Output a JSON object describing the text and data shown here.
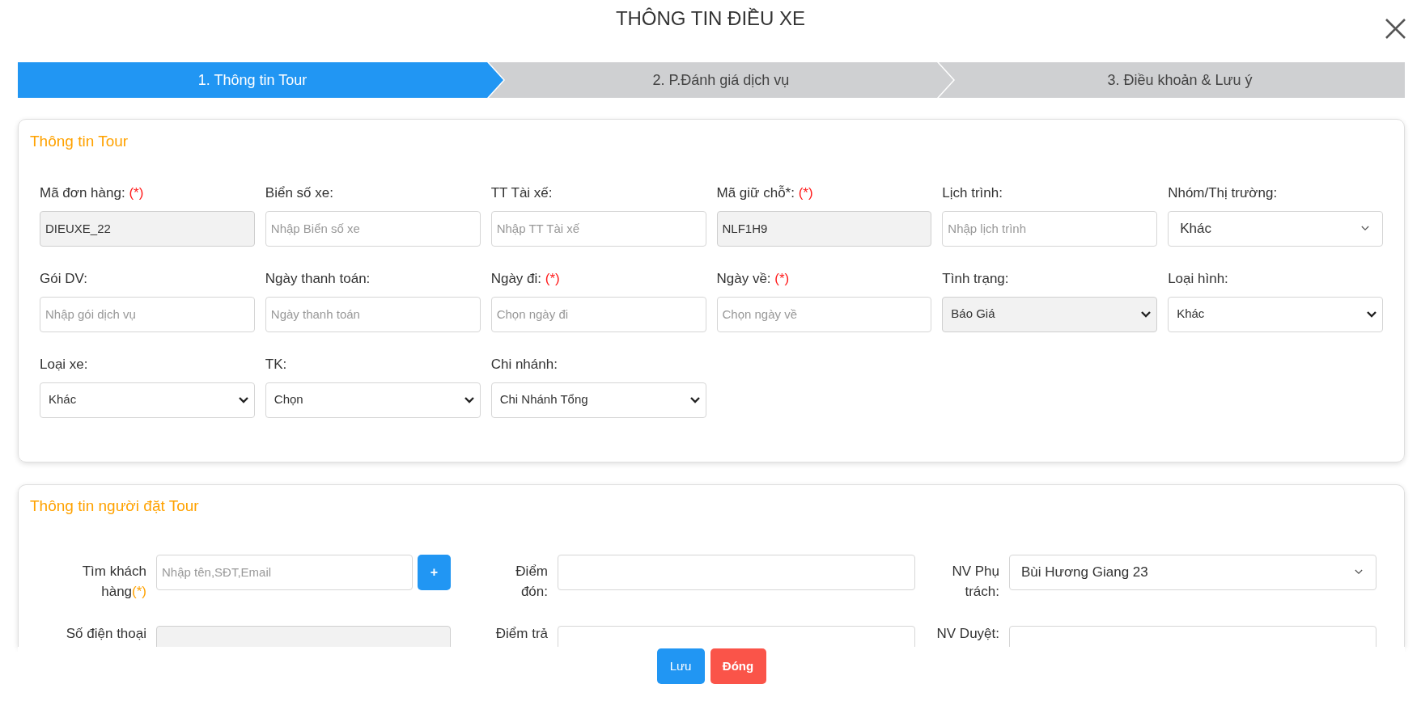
{
  "window": {
    "title": "THÔNG TIN ĐIỀU XE"
  },
  "steps": [
    {
      "label": "1. Thông tin Tour",
      "selected": true
    },
    {
      "label": "2. P.Đánh giá dịch vụ",
      "selected": false
    },
    {
      "label": "3. Điều khoản & Lưu ý",
      "selected": false
    }
  ],
  "tour_info": {
    "title": "Thông tin Tour",
    "fields": [
      {
        "label": "Mã đơn hàng:",
        "mark": "(*)",
        "kind": "input",
        "value": "DIEUXE_22",
        "disabled": true
      },
      {
        "label": "Biển số xe:",
        "kind": "input",
        "placeholder": "Nhập Biển số xe",
        "disabled": false
      },
      {
        "label": "TT Tài xế:",
        "kind": "input",
        "placeholder": "Nhập TT Tài xế",
        "disabled": false
      },
      {
        "label": "Mã giữ chỗ*:",
        "mark": "(*)",
        "kind": "input",
        "value": "NLF1H9",
        "disabled": true
      },
      {
        "label": "Lịch trình:",
        "kind": "input",
        "placeholder": "Nhập lịch trình",
        "disabled": false
      },
      {
        "label": "Nhóm/Thị trường:",
        "kind": "combo",
        "value": "Khác",
        "disabled": false
      },
      {
        "label": "Gói DV:",
        "kind": "input",
        "placeholder": "Nhập gói dịch vụ",
        "disabled": false
      },
      {
        "label": "Ngày thanh toán:",
        "kind": "input",
        "placeholder": "Ngày thanh toán",
        "disabled": false
      },
      {
        "label": "Ngày đi:",
        "mark": "(*)",
        "kind": "input",
        "placeholder": "Chọn ngày đi",
        "disabled": false
      },
      {
        "label": "Ngày về:",
        "mark": "(*)",
        "kind": "input",
        "placeholder": "Chọn ngày về",
        "disabled": false
      },
      {
        "label": "Tình trạng:",
        "kind": "select",
        "value": "Báo Giá",
        "disabled": true
      },
      {
        "label": "Loại hình:",
        "kind": "select",
        "value": "Khác",
        "disabled": false
      },
      {
        "label": "Loại xe:",
        "kind": "select",
        "value": "Khác",
        "disabled": false
      },
      {
        "label": "TK:",
        "kind": "select",
        "value": "Chọn",
        "disabled": false
      },
      {
        "label": "Chi nhánh:",
        "kind": "select",
        "value": "Chi Nhánh Tổng",
        "disabled": false
      }
    ]
  },
  "booker_info": {
    "title": "Thông tin người đặt Tour",
    "rows": [
      [
        {
          "label": "Tìm khách hàng",
          "mark": "(*)",
          "kind": "input",
          "placeholder": "Nhập tên,SĐT,Email",
          "disabled": false,
          "button": "+"
        },
        {
          "label": "Điểm đón:",
          "kind": "input",
          "disabled": false
        },
        {
          "label": "NV Phụ trách:",
          "kind": "combo",
          "value": "Bùi Hương Giang 23",
          "disabled": false
        }
      ],
      [
        {
          "label": "Số điện thoại",
          "kind": "input",
          "disabled": true
        },
        {
          "label": "Điểm trả",
          "kind": "input",
          "disabled": false
        },
        {
          "label": "NV Duyệt:",
          "kind": "input",
          "disabled": false
        }
      ]
    ]
  },
  "buttons": [
    {
      "label": "Lưu",
      "kind": "primary"
    },
    {
      "label": "Đóng",
      "kind": "danger"
    }
  ]
}
